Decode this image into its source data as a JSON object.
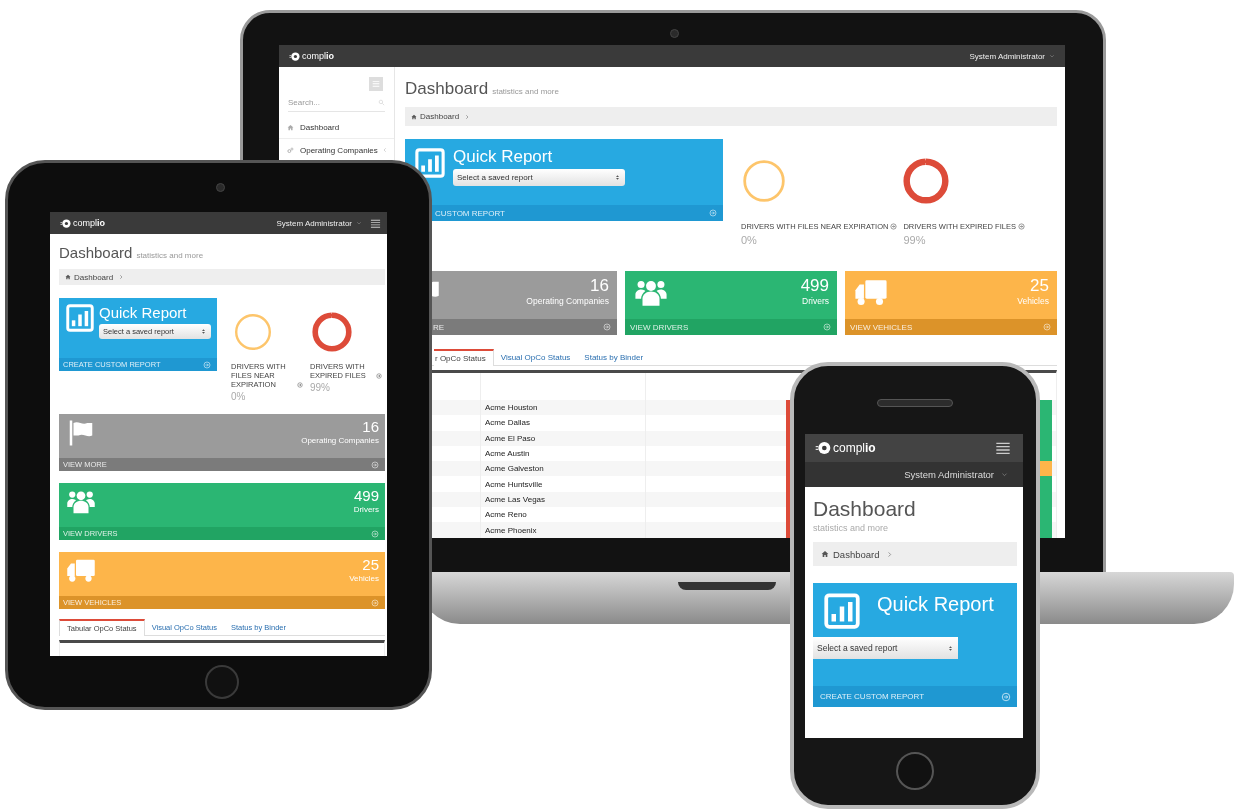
{
  "laptop": {
    "brand": "compl**io**",
    "user": "System Administrator",
    "sidebar": {
      "search": {
        "placeholder": "Search..."
      },
      "items": [
        {
          "kind": "home",
          "label": "Dashboard"
        },
        {
          "kind": "group",
          "label": "Operating Companies",
          "expanded": false
        }
      ]
    },
    "page": {
      "title": "Dashboard",
      "subtitle": "statistics and more",
      "breadcrumb": "Dashboard"
    },
    "quick_report": {
      "title": "Quick Report",
      "select_placeholder": "Select a saved report",
      "footer": "CUSTOM REPORT"
    },
    "gauges": [
      {
        "label": "DRIVERS WITH FILES NEAR EXPIRATION",
        "value": "0%",
        "color": "#fdc56b"
      },
      {
        "label": "DRIVERS WITH EXPIRED FILES",
        "value": "99%",
        "color": "#dd4b39"
      }
    ],
    "stats": [
      {
        "kind": "companies",
        "value": "16",
        "label": "Operating Companies",
        "link": "RE"
      },
      {
        "kind": "drivers",
        "value": "499",
        "label": "Drivers",
        "link": "VIEW DRIVERS"
      },
      {
        "kind": "vehicles",
        "value": "25",
        "label": "Vehicles",
        "link": "VIEW VEHICLES"
      }
    ],
    "tabs": [
      {
        "label": "r OpCo Status",
        "selected": true
      },
      {
        "label": "Visual OpCo Status",
        "selected": false
      },
      {
        "label": "Status by Binder",
        "selected": false
      }
    ],
    "table": {
      "rows": [
        {
          "name": "Acme Houston",
          "cells": [
            {
              "color": "#dd4b39"
            },
            {
              "color": "#2bb673"
            }
          ]
        },
        {
          "name": "Acme Dallas",
          "cells": [
            {
              "color": "#dd4b39"
            },
            {
              "color": "#2bb673"
            }
          ]
        },
        {
          "name": "Acme El Paso",
          "cells": [
            {
              "color": "#dd4b39"
            },
            {
              "color": "#2bb673"
            }
          ]
        },
        {
          "name": "Acme Austin",
          "cells": [
            {
              "color": "#dd4b39"
            },
            {
              "color": "#2bb673"
            }
          ]
        },
        {
          "name": "Acme Galveston",
          "cells": [
            {
              "color": "#dd4b39"
            },
            {
              "color": "#fdb54a"
            }
          ]
        },
        {
          "name": "Acme Huntsville",
          "cells": [
            {
              "color": "#dd4b39"
            },
            {
              "color": "#2bb673"
            }
          ]
        },
        {
          "name": "Acme Las Vegas",
          "cells": [
            {
              "color": "#dd4b39"
            },
            {
              "color": "#2bb673"
            }
          ]
        },
        {
          "name": "Acme Reno",
          "cells": [
            {
              "color": "#dd4b39"
            },
            {
              "color": "#2bb673"
            }
          ]
        },
        {
          "name": "Acme Phoenix",
          "cells": [
            {
              "color": "#dd4b39"
            },
            {
              "color": "#2bb673"
            }
          ]
        }
      ]
    }
  },
  "tablet": {
    "brand": "compl**io**",
    "user": "System Administrator",
    "page": {
      "title": "Dashboard",
      "subtitle": "statistics and more",
      "breadcrumb": "Dashboard"
    },
    "quick_report": {
      "title": "Quick Report",
      "select_placeholder": "Select a saved report",
      "footer": "CREATE CUSTOM REPORT"
    },
    "gauges": [
      {
        "label": "DRIVERS WITH FILES NEAR EXPIRATION",
        "value": "0%",
        "color": "#fdc56b"
      },
      {
        "label": "DRIVERS WITH EXPIRED FILES",
        "value": "99%",
        "color": "#dd4b39"
      }
    ],
    "stats": [
      {
        "kind": "companies",
        "value": "16",
        "label": "Operating Companies",
        "link": "VIEW MORE"
      },
      {
        "kind": "drivers",
        "value": "499",
        "label": "Drivers",
        "link": "VIEW DRIVERS"
      },
      {
        "kind": "vehicles",
        "value": "25",
        "label": "Vehicles",
        "link": "VIEW VEHICLES"
      }
    ],
    "tabs": [
      {
        "label": "Tabular OpCo Status",
        "selected": true
      },
      {
        "label": "Visual OpCo Status",
        "selected": false
      },
      {
        "label": "Status by Binder",
        "selected": false
      }
    ]
  },
  "phone": {
    "brand": "compl**io**",
    "user": "System Administrator",
    "page": {
      "title": "Dashboard",
      "subtitle": "statistics and more",
      "breadcrumb": "Dashboard"
    },
    "quick_report": {
      "title": "Quick Report",
      "select_placeholder": "Select a saved report",
      "footer": "CREATE CUSTOM REPORT"
    }
  }
}
